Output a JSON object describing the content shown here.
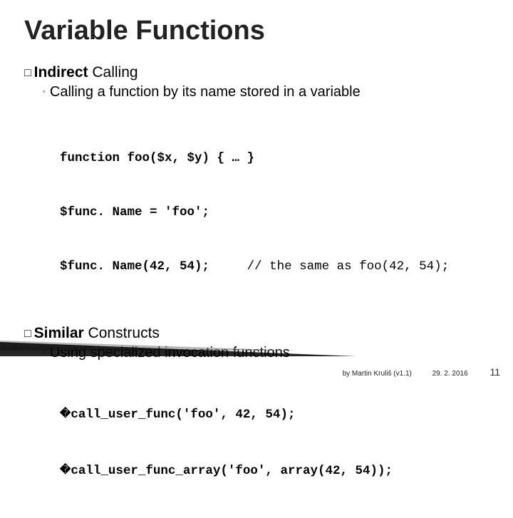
{
  "title": "Variable Functions",
  "section1": {
    "bullet": "□",
    "heading_prefix": "Indirect ",
    "heading_rest": "Calling",
    "sub_diamond": "◦",
    "sub_text": "Calling a function by its name stored in a variable",
    "code_line1": "function foo($x, $y) { … }",
    "code_line2": "$func. Name = 'foo';",
    "code_line3_left": "$func. Name(42, 54);",
    "code_line3_right": "// the same as foo(42, 54);"
  },
  "section2": {
    "bullet": "□",
    "heading_prefix": "Similar ",
    "heading_rest": "Constructs",
    "sub_diamond": "◦",
    "sub_text": "Using specialized invocation functions",
    "box": "�",
    "code_line1": "call_user_func('foo', 42, 54);",
    "code_line2": "call_user_func_array('foo', array(42, 54));"
  },
  "footer": {
    "by": "by Martin Kruliš (v1.1)",
    "date": "29. 2. 2016",
    "page": "11"
  }
}
